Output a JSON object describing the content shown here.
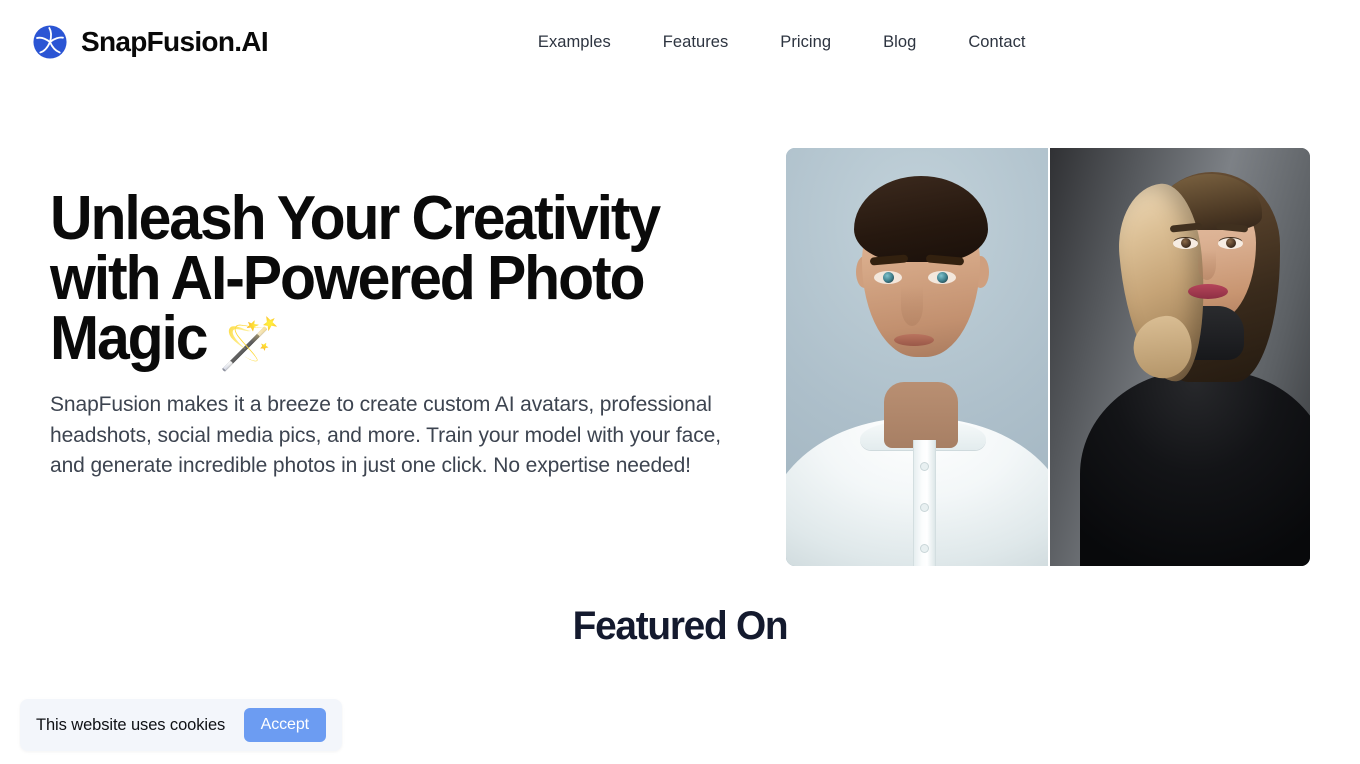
{
  "header": {
    "brand": {
      "icon": "camera-aperture-icon",
      "name": "SnapFusion.AI",
      "color": "#2b55d4"
    },
    "nav": [
      {
        "label": "Examples"
      },
      {
        "label": "Features"
      },
      {
        "label": "Pricing"
      },
      {
        "label": "Blog"
      },
      {
        "label": "Contact"
      }
    ]
  },
  "hero": {
    "title_line1": "Unleash Your Creativity",
    "title_line2": "with AI-Powered Photo",
    "title_line3": "Magic",
    "title_emoji": "🪄",
    "subtitle": "SnapFusion makes it a breeze to create custom AI avatars, professional headshots, social media pics, and more. Train your model with your face, and generate incredible photos in just one click. No expertise needed!",
    "image": {
      "alt_left": "ai-generated-male-headshot",
      "alt_right": "ai-generated-female-headshot"
    }
  },
  "featured": {
    "title": "Featured On"
  },
  "cookie_banner": {
    "message": "This website uses cookies",
    "accept_label": "Accept",
    "accept_color": "#6c9cf2",
    "background": "#f3f6fb"
  }
}
